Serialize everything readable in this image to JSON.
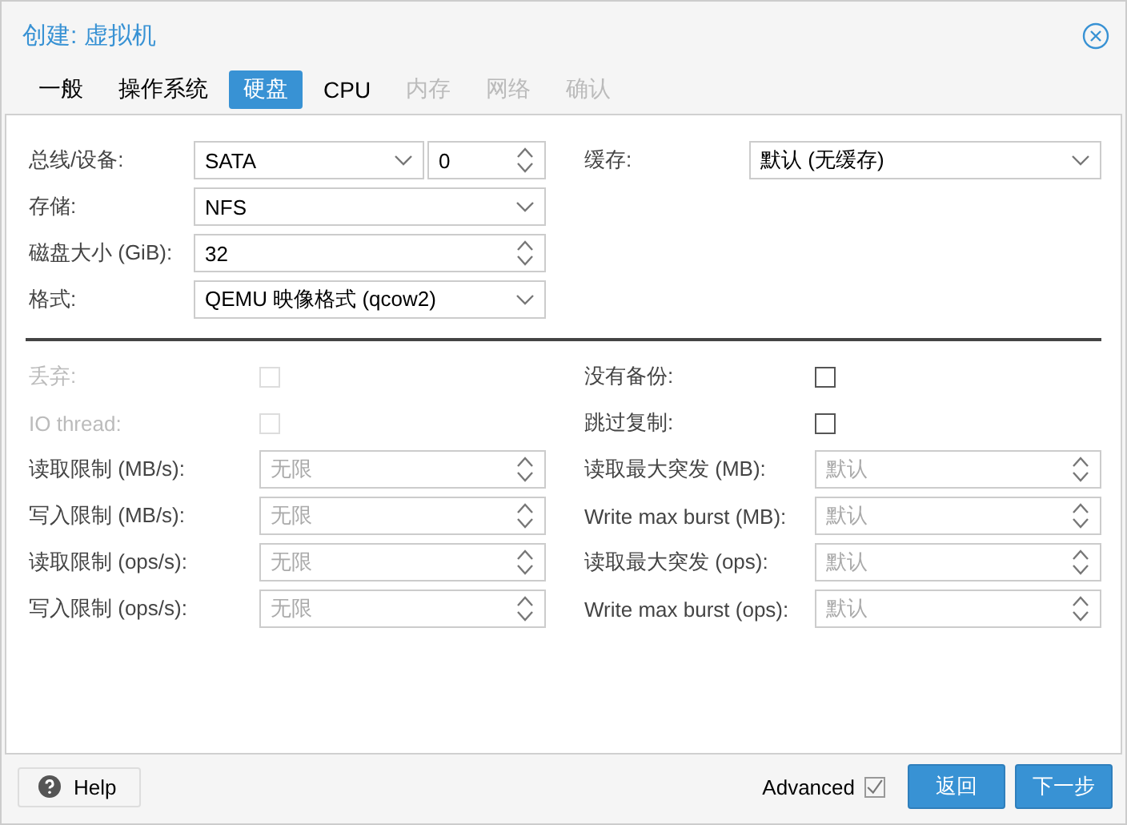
{
  "window": {
    "title": "创建: 虚拟机"
  },
  "tabs": [
    {
      "label": "一般",
      "selected": false,
      "disabled": false
    },
    {
      "label": "操作系统",
      "selected": false,
      "disabled": false
    },
    {
      "label": "硬盘",
      "selected": true,
      "disabled": false
    },
    {
      "label": "CPU",
      "selected": false,
      "disabled": false
    },
    {
      "label": "内存",
      "selected": false,
      "disabled": true
    },
    {
      "label": "网络",
      "selected": false,
      "disabled": true
    },
    {
      "label": "确认",
      "selected": false,
      "disabled": true
    }
  ],
  "basic_left": [
    {
      "label": "总线/设备:",
      "controls": [
        {
          "kind": "select",
          "value": "SATA"
        },
        {
          "kind": "spinner",
          "value": "0"
        }
      ]
    },
    {
      "label": "存储:",
      "controls": [
        {
          "kind": "select",
          "value": "NFS"
        }
      ]
    },
    {
      "label": "磁盘大小 (GiB):",
      "controls": [
        {
          "kind": "spinner",
          "value": "32"
        }
      ]
    },
    {
      "label": "格式:",
      "controls": [
        {
          "kind": "select",
          "value": "QEMU 映像格式 (qcow2)"
        }
      ]
    }
  ],
  "basic_right": [
    {
      "label": "缓存:",
      "controls": [
        {
          "kind": "select",
          "value": "默认 (无缓存)"
        }
      ]
    }
  ],
  "advanced_left": [
    {
      "kind": "checkbox",
      "label": "丢弃:",
      "checked": false,
      "disabled": true
    },
    {
      "kind": "checkbox",
      "label": "IO thread:",
      "checked": false,
      "disabled": true
    },
    {
      "kind": "spinner",
      "label": "读取限制 (MB/s):",
      "placeholder": "无限"
    },
    {
      "kind": "spinner",
      "label": "写入限制 (MB/s):",
      "placeholder": "无限"
    },
    {
      "kind": "spinner",
      "label": "读取限制 (ops/s):",
      "placeholder": "无限"
    },
    {
      "kind": "spinner",
      "label": "写入限制 (ops/s):",
      "placeholder": "无限"
    }
  ],
  "advanced_right": [
    {
      "kind": "checkbox",
      "label": "没有备份:",
      "checked": false,
      "disabled": false
    },
    {
      "kind": "checkbox",
      "label": "跳过复制:",
      "checked": false,
      "disabled": false
    },
    {
      "kind": "spinner",
      "label": "读取最大突发 (MB):",
      "placeholder": "默认"
    },
    {
      "kind": "spinner",
      "label": "Write max burst (MB):",
      "placeholder": "默认"
    },
    {
      "kind": "spinner",
      "label": "读取最大突发 (ops):",
      "placeholder": "默认"
    },
    {
      "kind": "spinner",
      "label": "Write max burst (ops):",
      "placeholder": "默认"
    }
  ],
  "footer": {
    "help": "Help",
    "advanced": {
      "label": "Advanced",
      "checked": true
    },
    "buttons": [
      "返回",
      "下一步"
    ]
  }
}
